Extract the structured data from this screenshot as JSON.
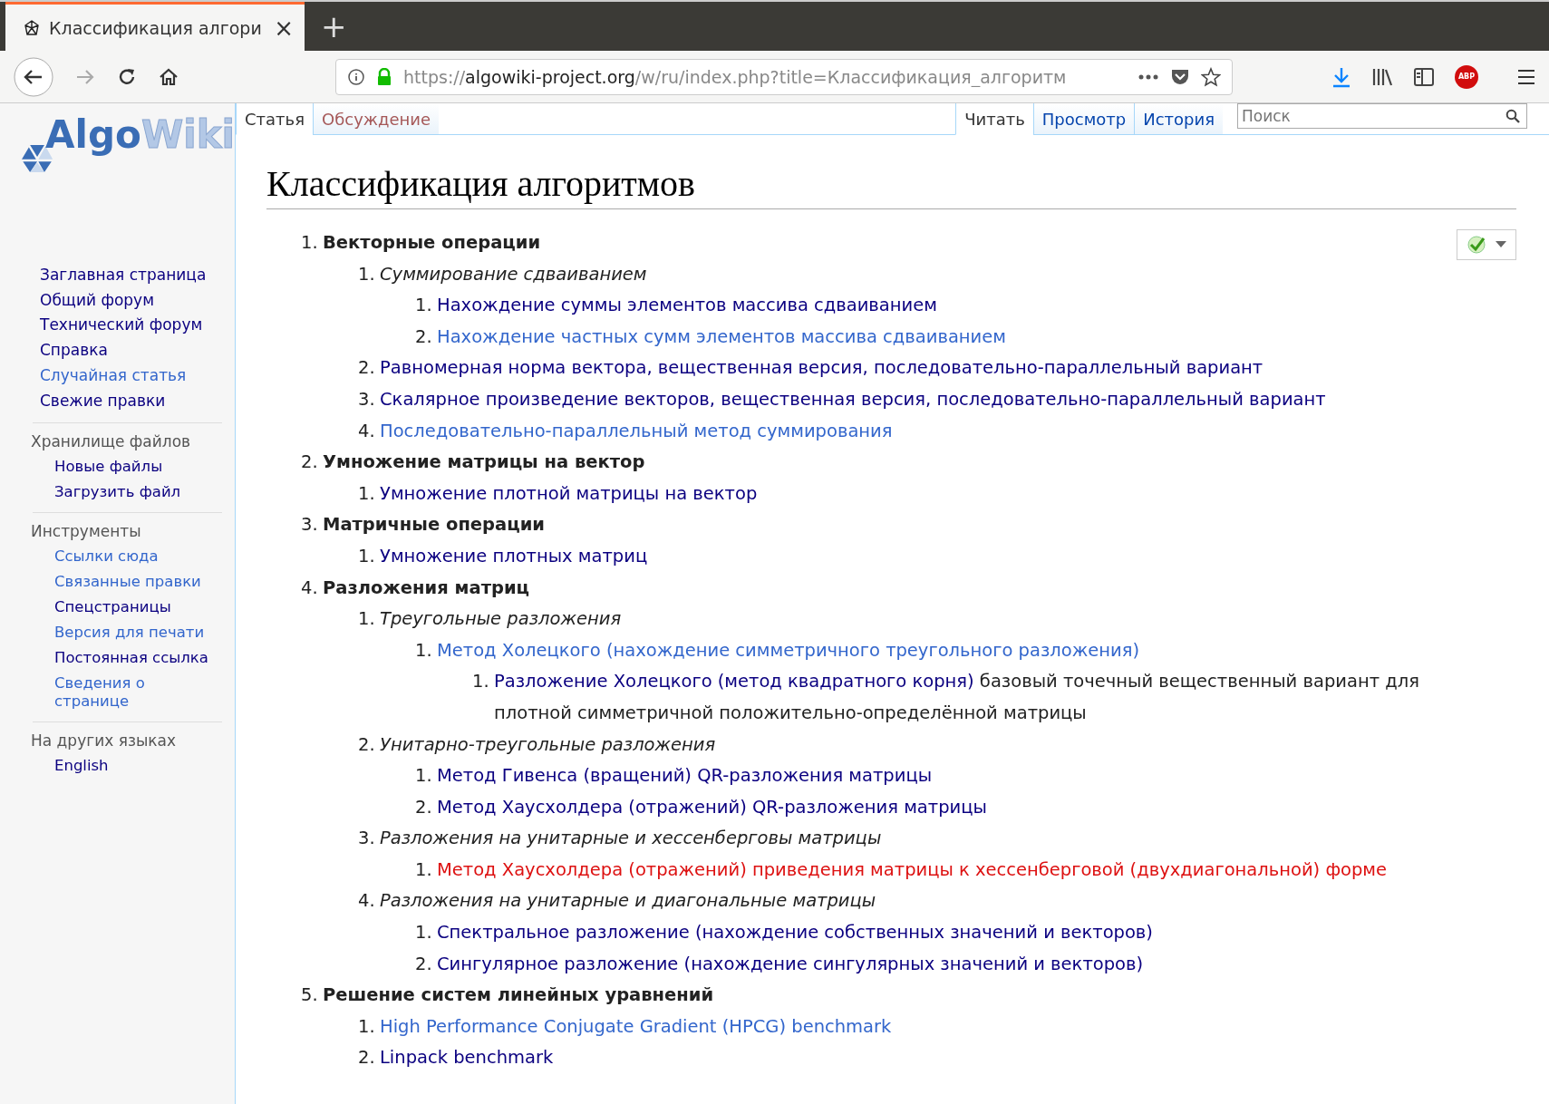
{
  "browser": {
    "tab": {
      "title": "Классификация алгори",
      "close": "×"
    },
    "new_tab": "+",
    "url": {
      "scheme": "https://",
      "domain": "algowiki-project.org",
      "path": "/w/ru/index.php?title=Классификация_алгоритм"
    },
    "adblock_label": "ABP"
  },
  "logo": {
    "part_1": "Algo",
    "part_2": "Wiki"
  },
  "sidebar": {
    "items": [
      {
        "label": "Заглавная страница",
        "visited": true
      },
      {
        "label": "Общий форум",
        "visited": true
      },
      {
        "label": "Технический форум",
        "visited": true
      },
      {
        "label": "Справка",
        "visited": true
      },
      {
        "label": "Случайная статья",
        "visited": false
      },
      {
        "label": "Свежие правки",
        "visited": true
      }
    ],
    "sections": [
      {
        "title": "Хранилище файлов",
        "items": [
          {
            "label": "Новые файлы",
            "visited": true
          },
          {
            "label": "Загрузить файл",
            "visited": true
          }
        ]
      },
      {
        "title": "Инструменты",
        "items": [
          {
            "label": "Ссылки сюда",
            "visited": false
          },
          {
            "label": "Связанные правки",
            "visited": false
          },
          {
            "label": "Спецстраницы",
            "visited": true
          },
          {
            "label": "Версия для печати",
            "visited": false
          },
          {
            "label": "Постоянная ссылка",
            "visited": true
          },
          {
            "label": "Сведения о странице",
            "visited": false
          }
        ]
      },
      {
        "title": "На других языках",
        "items": [
          {
            "label": "English",
            "visited": true
          }
        ]
      }
    ]
  },
  "page_tabs": [
    {
      "label": "Статья",
      "selected": true,
      "missing": false
    },
    {
      "label": "Обсуждение",
      "selected": false,
      "missing": true
    }
  ],
  "view_tabs": [
    {
      "label": "Читать",
      "selected": true
    },
    {
      "label": "Просмотр",
      "selected": false
    },
    {
      "label": "История",
      "selected": false
    }
  ],
  "search": {
    "placeholder": "Поиск"
  },
  "title": "Классификация алгоритмов",
  "outline": [
    {
      "number": "1.",
      "kind": "section",
      "text": "Векторные операции",
      "children": [
        {
          "number": "1.",
          "kind": "group",
          "text": "Суммирование сдваиванием",
          "children": [
            {
              "number": "1.",
              "kind": "link",
              "visited": true,
              "missing": false,
              "text": "Нахождение суммы элементов массива сдваиванием"
            },
            {
              "number": "2.",
              "kind": "link",
              "visited": false,
              "missing": false,
              "text": "Нахождение частных сумм элементов массива сдваиванием"
            }
          ]
        },
        {
          "number": "2.",
          "kind": "link",
          "visited": true,
          "missing": false,
          "text": "Равномерная норма вектора, вещественная версия, последовательно-параллельный вариант"
        },
        {
          "number": "3.",
          "kind": "link",
          "visited": true,
          "missing": false,
          "text": "Скалярное произведение векторов, вещественная версия, последовательно-параллельный вариант"
        },
        {
          "number": "4.",
          "kind": "link",
          "visited": false,
          "missing": false,
          "text": "Последовательно-параллельный метод суммирования"
        }
      ]
    },
    {
      "number": "2.",
      "kind": "section",
      "text": "Умножение матрицы на вектор",
      "children": [
        {
          "number": "1.",
          "kind": "link",
          "visited": true,
          "missing": false,
          "text": "Умножение плотной матрицы на вектор"
        }
      ]
    },
    {
      "number": "3.",
      "kind": "section",
      "text": "Матричные операции",
      "children": [
        {
          "number": "1.",
          "kind": "link",
          "visited": true,
          "missing": false,
          "text": "Умножение плотных матриц"
        }
      ]
    },
    {
      "number": "4.",
      "kind": "section",
      "text": "Разложения матриц",
      "children": [
        {
          "number": "1.",
          "kind": "group",
          "text": "Треугольные разложения",
          "children": [
            {
              "number": "1.",
              "kind": "link",
              "visited": false,
              "missing": false,
              "text": "Метод Холецкого (нахождение симметричного треугольного разложения)",
              "children": [
                {
                  "number": "1.",
                  "kind": "link",
                  "visited": true,
                  "missing": false,
                  "text": "Разложение Холецкого (метод квадратного корня)",
                  "note": "базовый точечный вещественный вариант для плотной симметричной положительно-определённой матрицы"
                }
              ]
            }
          ]
        },
        {
          "number": "2.",
          "kind": "group",
          "text": "Унитарно-треугольные разложения",
          "children": [
            {
              "number": "1.",
              "kind": "link",
              "visited": true,
              "missing": false,
              "text": "Метод Гивенса (вращений) QR-разложения матрицы"
            },
            {
              "number": "2.",
              "kind": "link",
              "visited": true,
              "missing": false,
              "text": "Метод Хаусхолдера (отражений) QR-разложения матрицы"
            }
          ]
        },
        {
          "number": "3.",
          "kind": "group",
          "text": "Разложения на унитарные и хессенберговы матрицы",
          "children": [
            {
              "number": "1.",
              "kind": "link",
              "visited": false,
              "missing": true,
              "text": "Метод Хаусхолдера (отражений) приведения матрицы к хессенберговой (двухдиагональной) форме"
            }
          ]
        },
        {
          "number": "4.",
          "kind": "group",
          "text": "Разложения на унитарные и диагональные матрицы",
          "children": [
            {
              "number": "1.",
              "kind": "link",
              "visited": true,
              "missing": false,
              "text": "Спектральное разложение (нахождение собственных значений и векторов)"
            },
            {
              "number": "2.",
              "kind": "link",
              "visited": true,
              "missing": false,
              "text": "Сингулярное разложение (нахождение сингулярных значений и векторов)"
            }
          ]
        }
      ]
    },
    {
      "number": "5.",
      "kind": "section",
      "text": "Решение систем линейных уравнений",
      "children": [
        {
          "number": "1.",
          "kind": "link",
          "visited": false,
          "missing": false,
          "text": "High Performance Conjugate Gradient (HPCG) benchmark"
        },
        {
          "number": "2.",
          "kind": "link",
          "visited": true,
          "missing": false,
          "text": "Linpack benchmark"
        }
      ]
    }
  ]
}
